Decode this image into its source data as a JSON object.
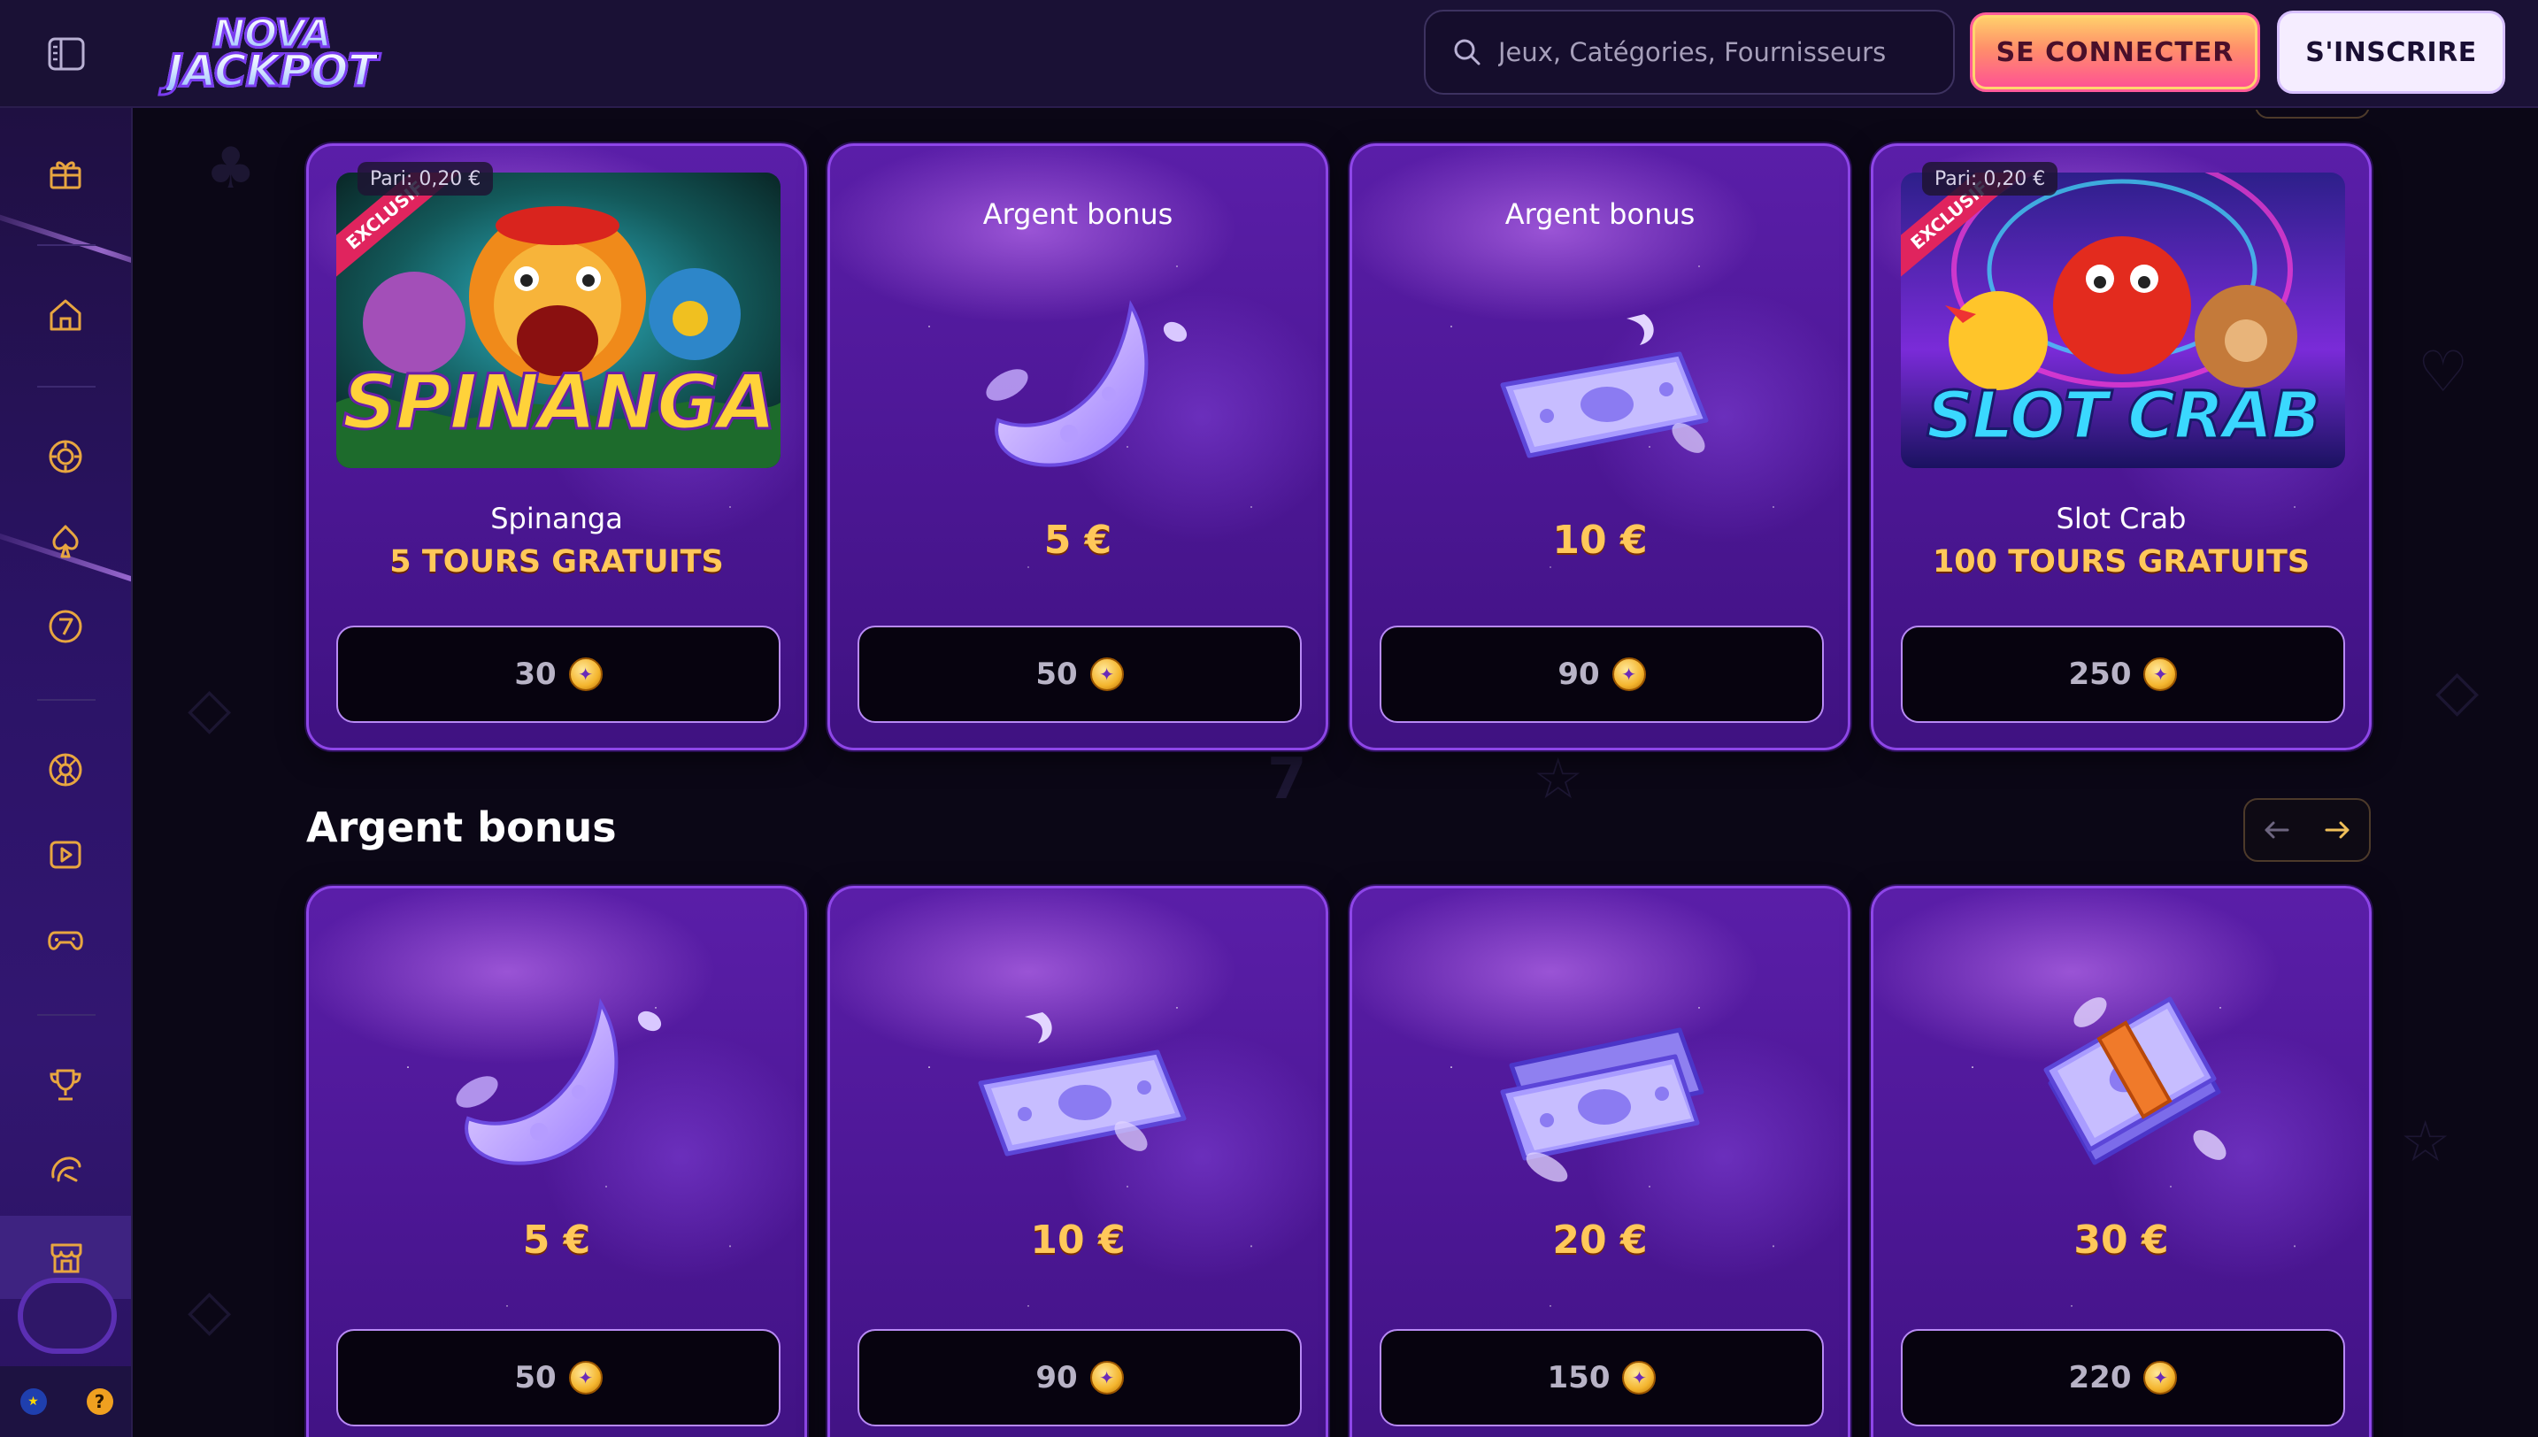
{
  "header": {
    "logo_line1": "NOVA",
    "logo_line2": "JACKPOT",
    "search_placeholder": "Jeux, Catégories, Fournisseurs",
    "login_label": "SE CONNECTER",
    "signup_label": "S'INSCRIRE"
  },
  "sidebar": {
    "items": [
      {
        "name": "promotions-icon"
      },
      {
        "name": "home-icon"
      },
      {
        "name": "casino-chip-icon"
      },
      {
        "name": "spade-icon"
      },
      {
        "name": "seven-icon"
      },
      {
        "name": "roulette-icon"
      },
      {
        "name": "video-play-icon"
      },
      {
        "name": "gamepad-icon"
      },
      {
        "name": "trophy-icon"
      },
      {
        "name": "speed-icon"
      },
      {
        "name": "shop-icon"
      }
    ],
    "help_label": "?"
  },
  "top_row": {
    "cards": [
      {
        "type": "game",
        "bet": "Pari: 0,20 €",
        "exclusive": "EXCLUSIF",
        "thumb_title": "SPINANGA",
        "name": "Spinanga",
        "reward": "5 TOURS GRATUITS",
        "price": "30"
      },
      {
        "type": "bonus",
        "label": "Argent bonus",
        "value": "5 €",
        "price": "50"
      },
      {
        "type": "bonus",
        "label": "Argent bonus",
        "value": "10 €",
        "price": "90"
      },
      {
        "type": "game",
        "bet": "Pari: 0,20 €",
        "exclusive": "EXCLUSIF",
        "thumb_title": "SLOT CRAB",
        "name": "Slot Crab",
        "reward": "100 TOURS GRATUITS",
        "price": "250"
      }
    ]
  },
  "bonus_section": {
    "title": "Argent bonus",
    "cards": [
      {
        "value": "5 €",
        "price": "50"
      },
      {
        "value": "10 €",
        "price": "90"
      },
      {
        "value": "20 €",
        "price": "150"
      },
      {
        "value": "30 €",
        "price": "220"
      }
    ]
  },
  "colors": {
    "accent_gold": "#ffc85a",
    "card_purple": "#5a1ea8",
    "login_pink": "#ff4f96"
  }
}
